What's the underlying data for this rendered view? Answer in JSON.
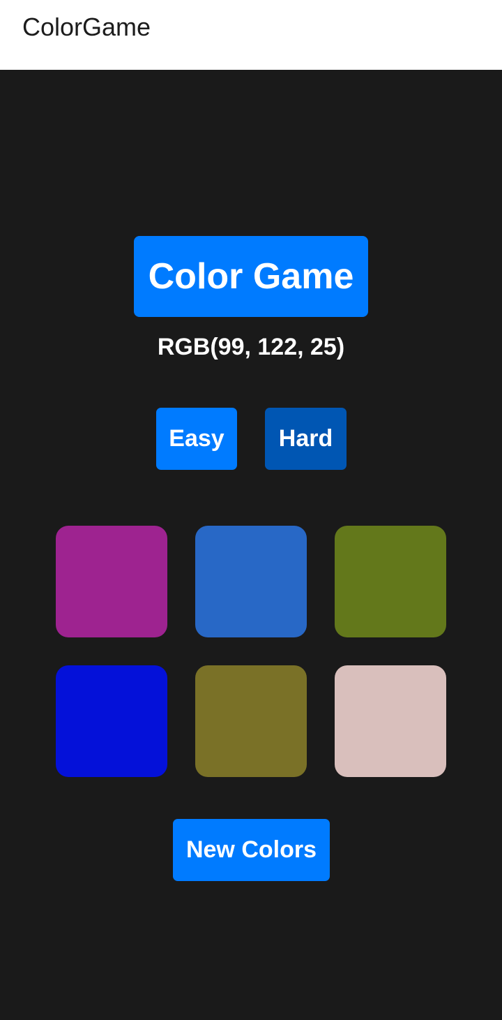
{
  "appbar": {
    "title": "ColorGame"
  },
  "game": {
    "title": "Color Game",
    "target_rgb": "RGB(99, 122, 25)",
    "accent_color": "#007bff",
    "active_mode_color": "#0056b3"
  },
  "modes": {
    "easy_label": "Easy",
    "hard_label": "Hard",
    "selected": "Hard"
  },
  "squares": [
    {
      "color": "#9e2390"
    },
    {
      "color": "#2868c6"
    },
    {
      "color": "#63781b"
    },
    {
      "color": "#0411d9"
    },
    {
      "color": "#7a7127"
    },
    {
      "color": "#d9bfbc"
    }
  ],
  "actions": {
    "new_colors_label": "New Colors"
  }
}
